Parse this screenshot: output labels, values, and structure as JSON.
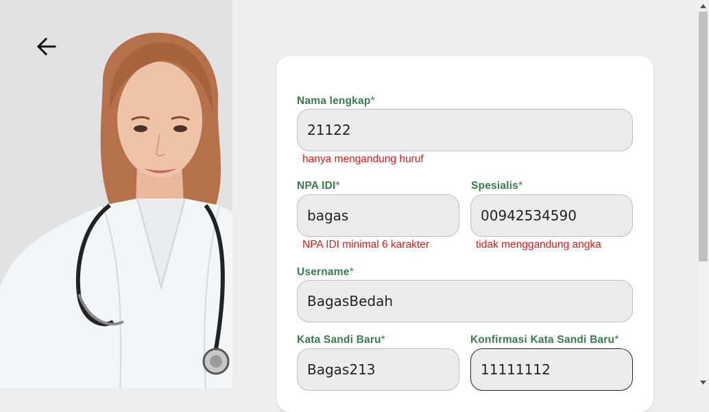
{
  "header": {
    "back_icon": "arrow-left-icon"
  },
  "form": {
    "nama_lengkap": {
      "label": "Nama lengkap",
      "required": "*",
      "value": "21122",
      "error": "hanya mengandung huruf"
    },
    "npa_idi": {
      "label": "NPA IDI",
      "required": "*",
      "value": "bagas",
      "error": "NPA IDI minimal 6 karakter"
    },
    "spesialis": {
      "label": "Spesialis",
      "required": "*",
      "value": "00942534590",
      "error": "tidak menggandung angka"
    },
    "username": {
      "label": "Username",
      "required": "*",
      "value": "BagasBedah"
    },
    "kata_sandi": {
      "label": "Kata Sandi Baru",
      "required": "*",
      "value": "Bagas213"
    },
    "konfirmasi": {
      "label": "Konfirmasi Kata Sandi Baru",
      "required": "*",
      "value": "11111112"
    }
  },
  "colors": {
    "label_green": "#3a7a4e",
    "error_red": "#d91c1c",
    "input_bg": "#ececec"
  }
}
